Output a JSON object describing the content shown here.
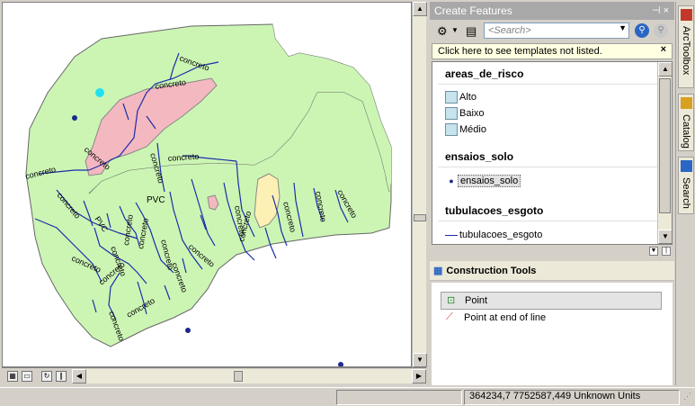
{
  "map": {
    "labels": [
      "concreto",
      "concreto",
      "concreto",
      "concreto",
      "concreto",
      "concreto",
      "concreto",
      "concreto",
      "PVC",
      "PVC",
      "concreto",
      "concreto",
      "concreto",
      "concreto",
      "concreto",
      "concreto",
      "concreto",
      "concreto",
      "concreto",
      "concreto",
      "concreto",
      "concreto",
      "concreto",
      "concreto"
    ]
  },
  "panel": {
    "title": "Create Features",
    "pin": "⊣ ×",
    "search_placeholder": "<Search>",
    "notice": "Click here to see templates not listed.",
    "notice_close": "×",
    "groups": [
      {
        "name": "areas_de_risco",
        "items": [
          "Alto",
          "Baixo",
          "Médio"
        ]
      },
      {
        "name": "ensaios_solo",
        "items": [
          "ensaios_solo"
        ]
      },
      {
        "name": "tubulacoes_esgoto",
        "items": [
          "tubulacoes_esgoto"
        ]
      }
    ],
    "construction_title": "Construction Tools",
    "tools": [
      "Point",
      "Point at end of line"
    ]
  },
  "side_tabs": [
    "ArcToolbox",
    "Catalog",
    "Search"
  ],
  "status": {
    "coords": "364234,7  7752587,449 Unknown Units"
  },
  "colors": {
    "polygon": "#ccf5b4",
    "risk": "#f4b8c0",
    "risk2": "#fdf0b4",
    "pipes": "#1a2ea8",
    "point": "#1a2a8c",
    "selected_point": "#22e0f0"
  }
}
